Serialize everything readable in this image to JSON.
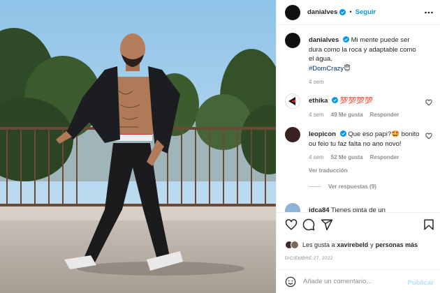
{
  "header": {
    "username": "danialves",
    "separator": "•",
    "follow_label": "Seguir"
  },
  "caption": {
    "username": "danialves",
    "text": "Mi mente puede ser dura como la roca y adaptable como el água.",
    "hashtag": "#DomCrazy",
    "emoji": "😇",
    "time": "4 sem"
  },
  "comments": [
    {
      "username": "ethika",
      "text": "💯💯💯💯",
      "time": "4 sem",
      "likes": "49 Me gusta",
      "reply": "Responder"
    },
    {
      "username": "leopicon",
      "text": "Que eso papi?🤩 bonito ou feio tu faz falta no ano novo!",
      "time": "4 sem",
      "likes": "52 Me gusta",
      "reply": "Responder",
      "translate": "Ver traducción",
      "view_replies": "Ver respuestas (9)"
    },
    {
      "username": "idca84",
      "text": "Tienes pinta de un"
    }
  ],
  "actions": {
    "icons": [
      "heart-icon",
      "comment-icon",
      "share-icon",
      "bookmark-icon"
    ],
    "likes_prefix": "Les gusta a",
    "likes_user": "xavirebeld",
    "likes_joiner": "y",
    "likes_suffix": "personas más",
    "date": "DICIEMBRE 27, 2022"
  },
  "add_comment": {
    "placeholder": "Añade un comentario...",
    "publish_label": "Publicar"
  },
  "colors": {
    "accent": "#0095f6",
    "publish_disabled": "#b2dffc",
    "muted": "#8e8e8e",
    "link": "#00376b"
  }
}
